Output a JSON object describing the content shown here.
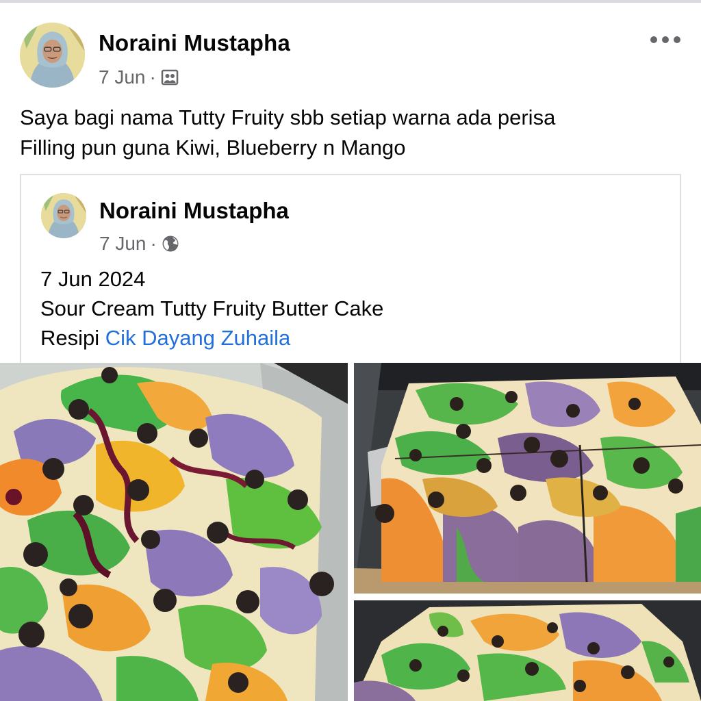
{
  "post": {
    "author": "Noraini Mustapha",
    "date": "7 Jun",
    "separator": "·",
    "audience_icon": "friends-icon",
    "caption_lines": [
      "Saya bagi nama Tutty Fruity sbb setiap warna ada perisa",
      "Filling pun guna Kiwi, Blueberry n Mango"
    ]
  },
  "shared_post": {
    "author": "Noraini Mustapha",
    "date": "7 Jun",
    "separator": "·",
    "audience_icon": "globe-icon",
    "line1": "7 Jun 2024",
    "line2": "Sour Cream Tutty Fruity Butter Cake",
    "line3_prefix": "Resipi ",
    "link_text": "Cik Dayang Zuhaila"
  },
  "photos": [
    {
      "subject": "batter-in-pan-photo"
    },
    {
      "subject": "baked-cake-slab-photo"
    },
    {
      "subject": "baked-cake-closeup-photo"
    }
  ],
  "colors": {
    "text": "#050505",
    "secondary_text": "#65676b",
    "link": "#216fdb",
    "card_border": "#dcdfe3"
  }
}
